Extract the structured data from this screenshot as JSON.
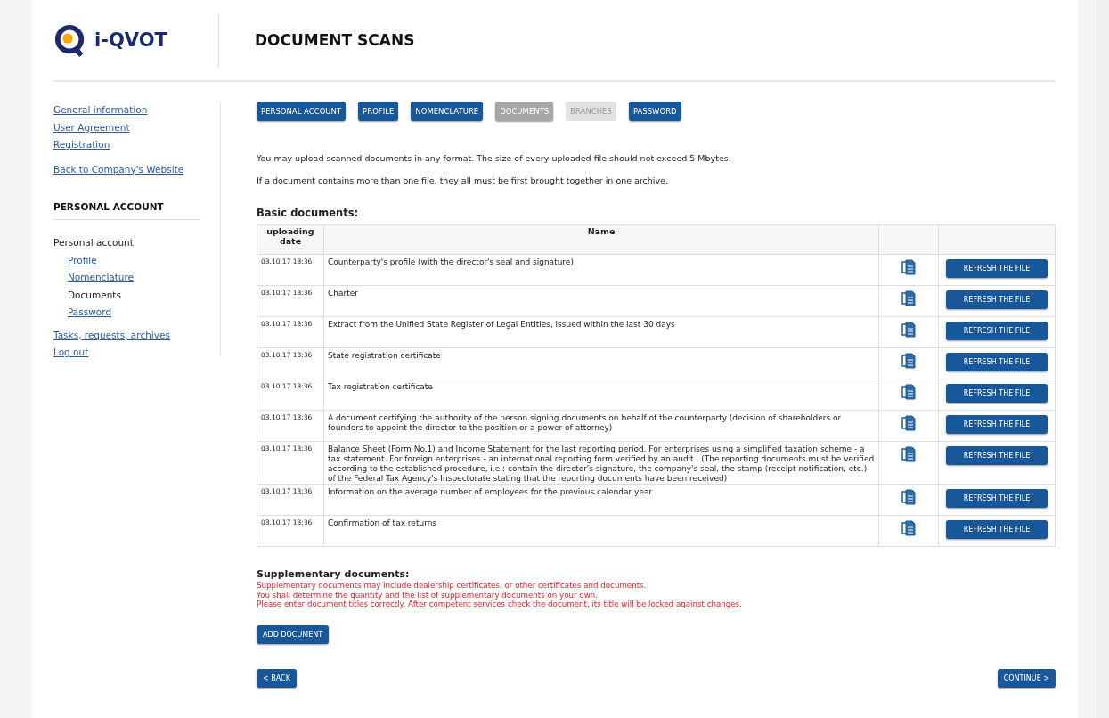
{
  "logo": {
    "text": "i-QVOT"
  },
  "page_title": "DOCUMENT SCANS",
  "sidebar": {
    "links": [
      "General information",
      "User Agreement",
      "Registration"
    ],
    "back_link": "Back to Company's Website",
    "section_title": "PERSONAL ACCOUNT",
    "tree": [
      {
        "label": "Personal account",
        "selected": false,
        "children": [
          {
            "label": "Profile",
            "selected": false
          },
          {
            "label": "Nomenclature",
            "selected": false
          },
          {
            "label": "Documents",
            "selected": true
          },
          {
            "label": "Password",
            "selected": false
          }
        ]
      },
      {
        "label": "Tasks, requests, archives",
        "selected": false
      },
      {
        "label": "Log out",
        "selected": false
      }
    ]
  },
  "tabs": [
    {
      "label": "PERSONAL ACCOUNT",
      "selected": false,
      "disabled": false
    },
    {
      "label": "PROFILE",
      "selected": false,
      "disabled": false
    },
    {
      "label": "NOMENCLATURE",
      "selected": false,
      "disabled": false
    },
    {
      "label": "DOCUMENTS",
      "selected": true,
      "disabled": false
    },
    {
      "label": "BRANCHES",
      "selected": false,
      "disabled": true
    },
    {
      "label": "PASSWORD",
      "selected": false,
      "disabled": false
    }
  ],
  "intro": [
    "You may upload scanned documents in any format. The size of every uploaded file should not exceed 5 Mbytes.",
    "If a document contains more than one file, they all must be first brought together in one archive."
  ],
  "basic": {
    "title": "Basic documents:",
    "columns": [
      "uploading date",
      "Name"
    ],
    "rows": [
      {
        "date": "03.10.17 13:36",
        "name": "Counterparty's profile (with the director's seal and signature)",
        "action": "REFRESH THE FILE"
      },
      {
        "date": "03.10.17 13:36",
        "name": "Charter",
        "action": "REFRESH THE FILE"
      },
      {
        "date": "03.10.17 13:36",
        "name": "Extract from the Unified State Register of Legal Entities, issued within the last 30 days",
        "action": "REFRESH THE FILE"
      },
      {
        "date": "03.10.17 13:36",
        "name": "State registration certificate",
        "action": "REFRESH THE FILE"
      },
      {
        "date": "03.10.17 13:36",
        "name": "Tax registration certificate",
        "action": "REFRESH THE FILE"
      },
      {
        "date": "03.10.17 13:36",
        "name": "A document certifying the authority of the person signing documents on behalf of the counterparty (decision of shareholders or founders to appoint the director to the position or a power of attorney)",
        "action": "REFRESH THE FILE"
      },
      {
        "date": "03.10.17 13:36",
        "name": "Balance Sheet (Form No.1) and Income Statement for the last reporting period. For enterprises using a simplified taxation scheme - a tax statement. For foreign enterprises - an international reporting form verified by an audit . (The reporting documents must be verified according to the established procedure, i.e.: contain the director's signature, the company's seal, the stamp (receipt notification, etc.) of the Federal Tax Agency's Inspectorate stating that the reporting documents have been received)",
        "action": "REFRESH THE FILE"
      },
      {
        "date": "03.10.17 13:36",
        "name": "Information on the average number of employees for the previous calendar year",
        "action": "REFRESH THE FILE"
      },
      {
        "date": "03.10.17 13:36",
        "name": "Confirmation of tax returns",
        "action": "REFRESH THE FILE"
      }
    ]
  },
  "supplementary": {
    "title": "Supplementary documents:",
    "notes": [
      "Supplementary documents may include dealership certificates, or other certificates and documents.",
      "You shall determine the quantity and the list of supplementary documents on your own.",
      "Please enter document titles correctly. After competent services check the document, its title will be locked against changes."
    ],
    "add_button": "ADD DOCUMENT"
  },
  "nav": {
    "back": "< BACK",
    "continue": "CONTINUE >"
  }
}
